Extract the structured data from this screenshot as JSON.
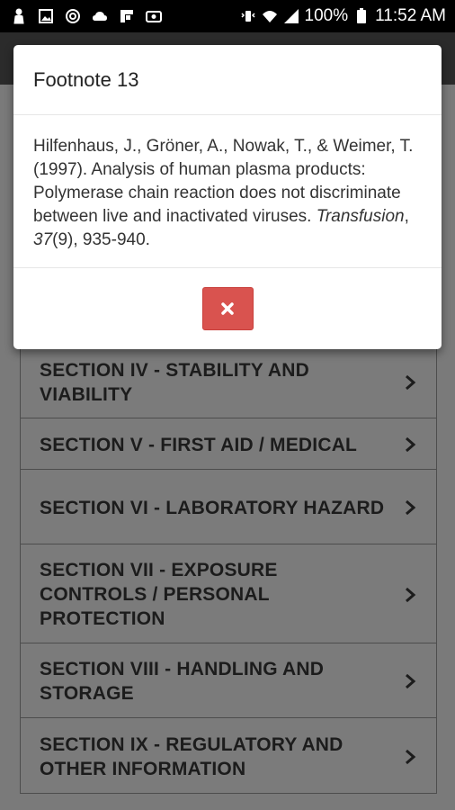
{
  "status_bar": {
    "left_icons": [
      "person-icon",
      "image-icon",
      "sync-icon",
      "cloud-icon",
      "flipboard-icon",
      "media-icon"
    ],
    "battery": "100%",
    "time": "11:52 AM"
  },
  "modal": {
    "title": "Footnote 13",
    "citation_prefix": "Hilfenhaus, J., Gröner, A., Nowak, T., & Weimer, T. (1997). Analysis of human plasma products: Polymerase chain reaction does not discriminate between live and inactivated viruses. ",
    "citation_journal": "Transfusion",
    "citation_sep": ", ",
    "citation_volume": "37",
    "citation_suffix": "(9), 935-940.",
    "close_icon": "close-icon",
    "close_color": "#d9534f"
  },
  "sections": [
    {
      "label": "SECTION IV - STABILITY AND VIABILITY"
    },
    {
      "label": "SECTION V - FIRST AID / MEDICAL"
    },
    {
      "label": "SECTION VI - LABORATORY HAZARD"
    },
    {
      "label": "SECTION VII - EXPOSURE CONTROLS / PERSONAL PROTECTION"
    },
    {
      "label": "SECTION VIII - HANDLING AND STORAGE"
    },
    {
      "label": "SECTION IX - REGULATORY AND OTHER INFORMATION"
    }
  ]
}
